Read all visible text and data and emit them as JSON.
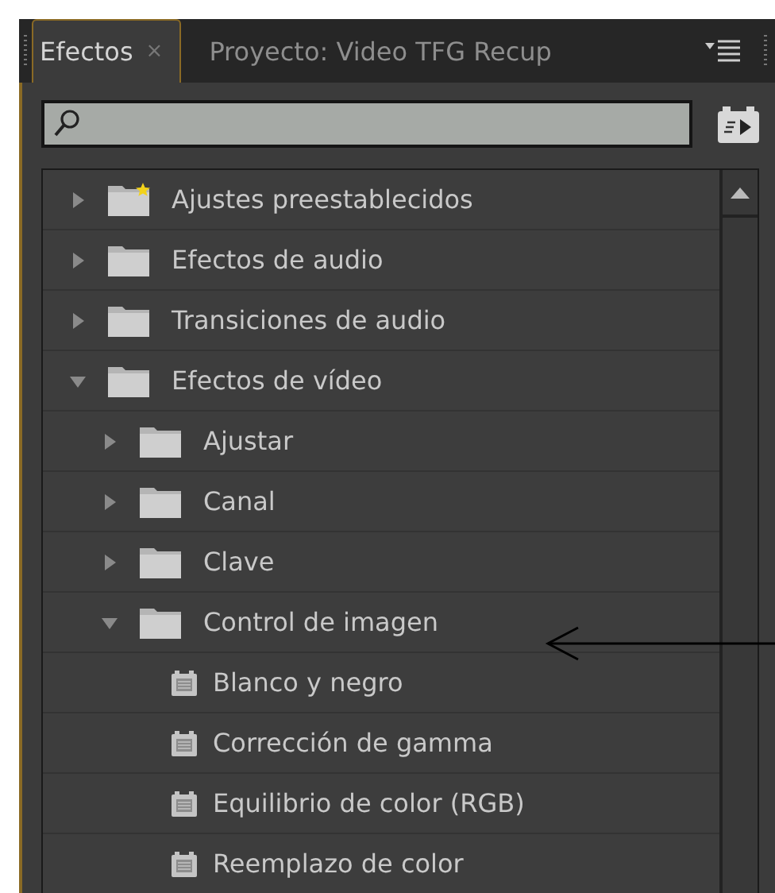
{
  "tabs": [
    {
      "label": "Efectos",
      "close": "×",
      "selected": true
    },
    {
      "label": "Proyecto: Video TFG Recup",
      "selected": false
    }
  ],
  "tree": [
    {
      "kind": "preset_folder",
      "label": "Ajustes preestablecidos",
      "expanded": false
    },
    {
      "kind": "folder",
      "label": "Efectos de audio",
      "expanded": false
    },
    {
      "kind": "folder",
      "label": "Transiciones de audio",
      "expanded": false
    },
    {
      "kind": "folder",
      "label": "Efectos de vídeo",
      "expanded": true,
      "children": [
        {
          "kind": "folder",
          "label": "Ajustar",
          "expanded": false
        },
        {
          "kind": "folder",
          "label": "Canal",
          "expanded": false
        },
        {
          "kind": "folder",
          "label": "Clave",
          "expanded": false
        },
        {
          "kind": "folder",
          "label": "Control de imagen",
          "expanded": true,
          "children": [
            {
              "kind": "effect",
              "label": "Blanco y negro"
            },
            {
              "kind": "effect",
              "label": "Corrección de gamma"
            },
            {
              "kind": "effect",
              "label": "Equilibrio de color (RGB)"
            },
            {
              "kind": "effect",
              "label": "Reemplazo de color"
            }
          ]
        }
      ]
    }
  ]
}
